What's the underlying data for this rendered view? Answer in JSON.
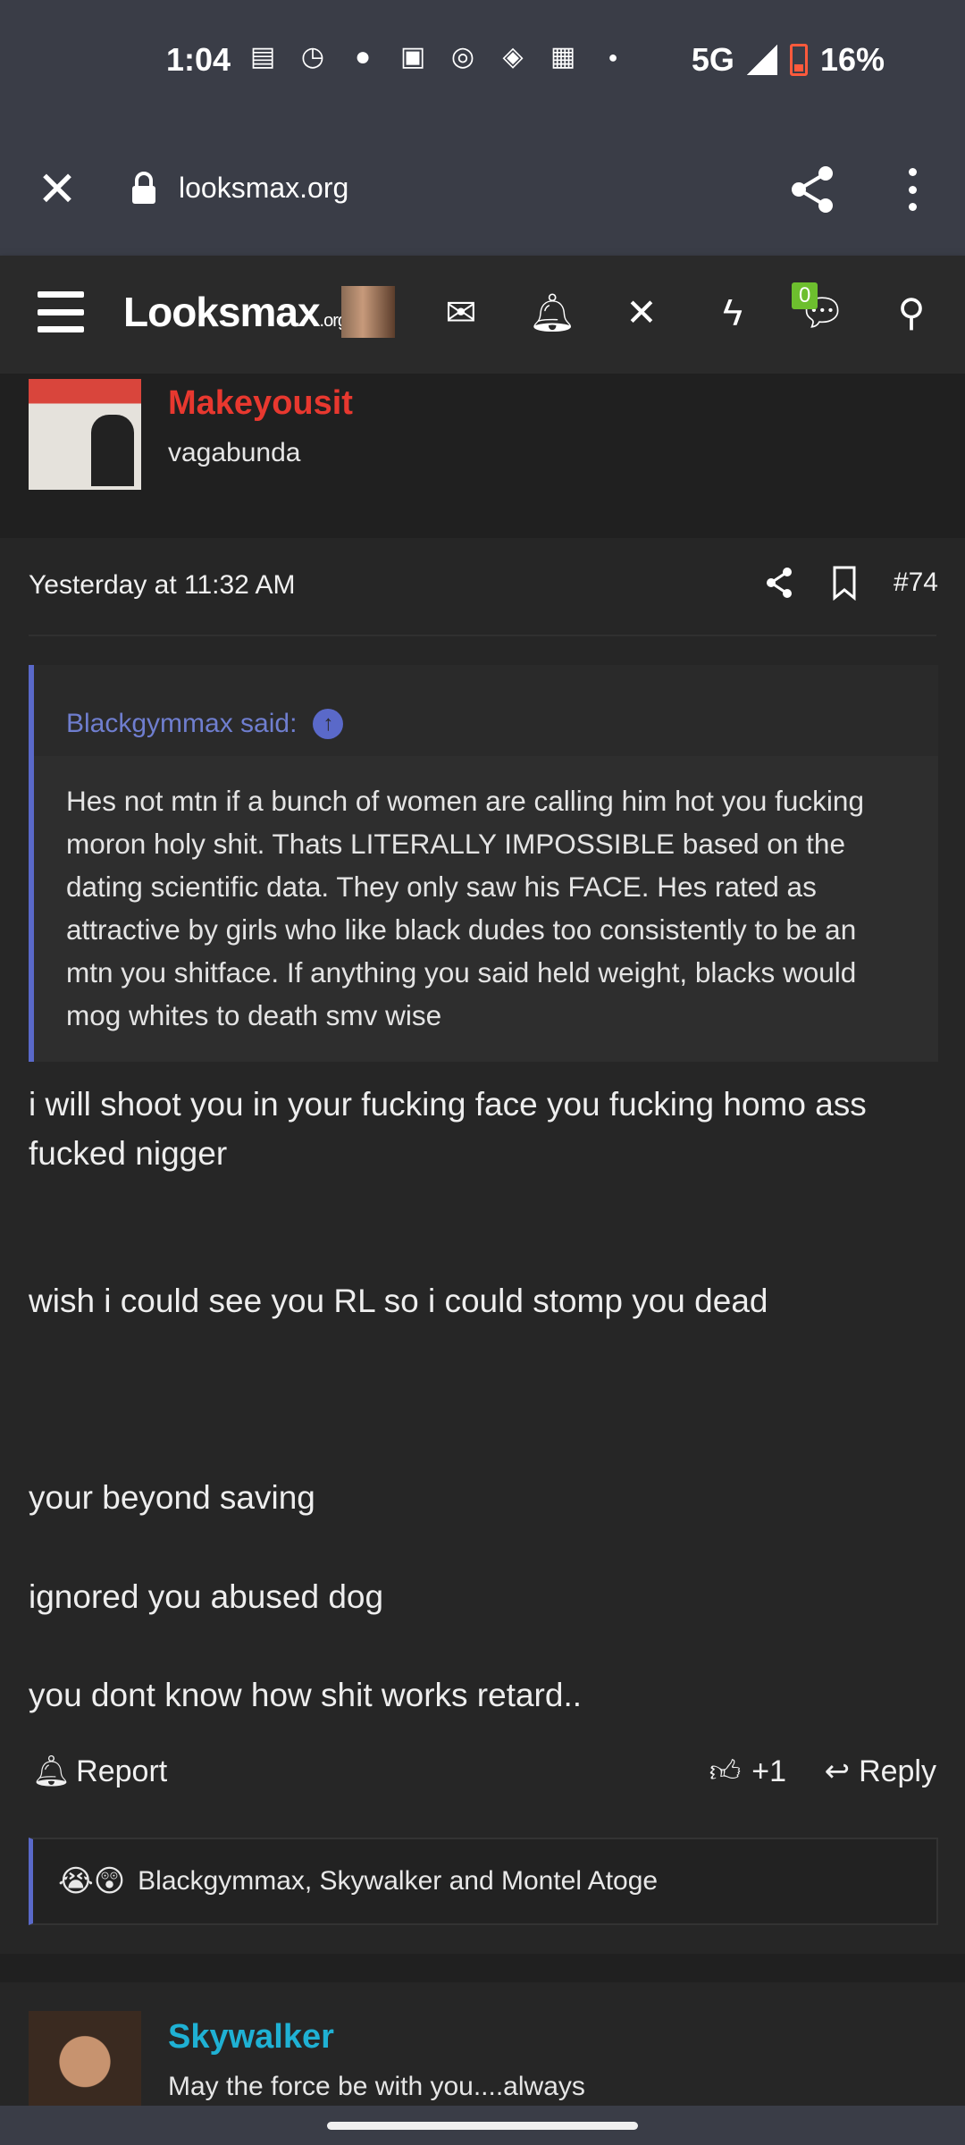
{
  "status_bar": {
    "time": "1:04",
    "network": "5G",
    "battery": "16%",
    "notification_icons": [
      "message-icon",
      "timer-icon",
      "reddit-icon",
      "twitch-icon",
      "instagram-icon",
      "binance-icon",
      "linkedin-icon",
      "dot-icon"
    ]
  },
  "browser": {
    "url": "looksmax.org"
  },
  "site_nav": {
    "logo_main": "Looksmax",
    "logo_suffix": ".org",
    "conversations_badge": "0"
  },
  "post_author": {
    "name": "Makeyousit",
    "title": "vagabunda",
    "name_color": "#e8382f"
  },
  "post": {
    "timestamp": "Yesterday at 11:32 AM",
    "number": "#74",
    "quote": {
      "author_label": "Blackgymmax said:",
      "text": "Hes not mtn if a bunch of women are calling him hot you fucking moron holy shit. Thats LITERALLY IMPOSSIBLE based on the dating scientific data. They only saw his FACE. Hes rated as attractive by girls who like black dudes too consistently to be an mtn you shitface. If anything you said held weight, blacks would mog whites to death smv wise"
    },
    "message_lines": [
      "i will shoot you in your fucking face you fucking homo ass fucked nigger",
      "wish i could see you RL so i could stomp you dead",
      "your beyond saving",
      "ignored you abused dog",
      "you dont know how shit works retard.."
    ],
    "report_label": "Report",
    "like_count": "+1",
    "reply_label": "Reply",
    "reactions": {
      "emojis": "😭😲",
      "users": "Blackgymmax, Skywalker and Montel Atoge"
    }
  },
  "next_author": {
    "name": "Skywalker",
    "title": "May the force be with you....always",
    "name_color": "#1fb1d4"
  },
  "colors": {
    "background": "#202020",
    "chrome": "#3a3d47",
    "quote_accent": "#5a69c9"
  }
}
